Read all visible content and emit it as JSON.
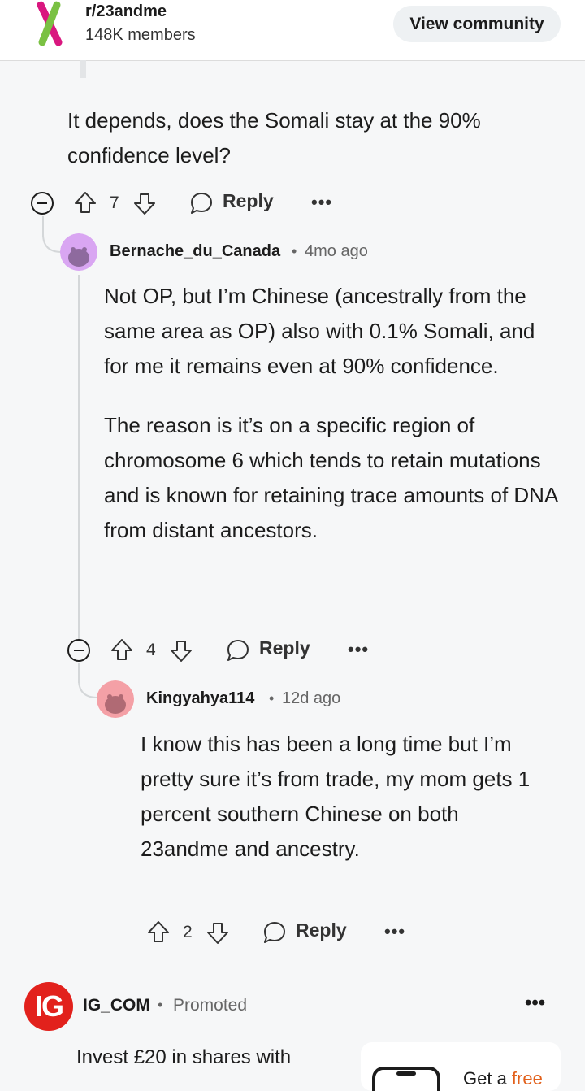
{
  "header": {
    "community_name": "r/23andme",
    "members": "148K members",
    "view_button": "View community"
  },
  "comments": [
    {
      "body": [
        "It depends, does the Somali stay at the 90% confidence level?"
      ],
      "votes": "7",
      "reply_label": "Reply",
      "more": "•••"
    },
    {
      "username": "Bernache_du_Canada",
      "separator": "•",
      "time": "4mo ago",
      "avatar_color": "#d9a6f2",
      "body": [
        "Not OP, but I’m Chinese (ancestrally from the same area as OP) also with 0.1% Somali, and for me it remains even at 90% confidence.",
        "The reason is it’s on a specific region of chromosome 6 which tends to retain mutations and is known for retaining trace amounts of DNA from distant ancestors."
      ],
      "votes": "4",
      "reply_label": "Reply",
      "more": "•••"
    },
    {
      "username": "Kingyahya114",
      "separator": "•",
      "time": "12d ago",
      "avatar_color": "#f4a0a6",
      "body": [
        "I know this has been a long time but I’m pretty sure it’s from trade, my mom gets 1 percent southern Chinese on both 23andme and ancestry."
      ],
      "votes": "2",
      "reply_label": "Reply",
      "more": "•••"
    }
  ],
  "ad": {
    "logo_text": "IG",
    "name": "IG_COM",
    "separator": "•",
    "label": "Promoted",
    "more": "•••",
    "text": "Invest £20 in shares with",
    "card_text_prefix": "Get a ",
    "card_text_highlight": "free"
  },
  "colors": {
    "accent_ad": "#e2211c",
    "highlight": "#e2611c",
    "background": "#f6f7f8"
  }
}
